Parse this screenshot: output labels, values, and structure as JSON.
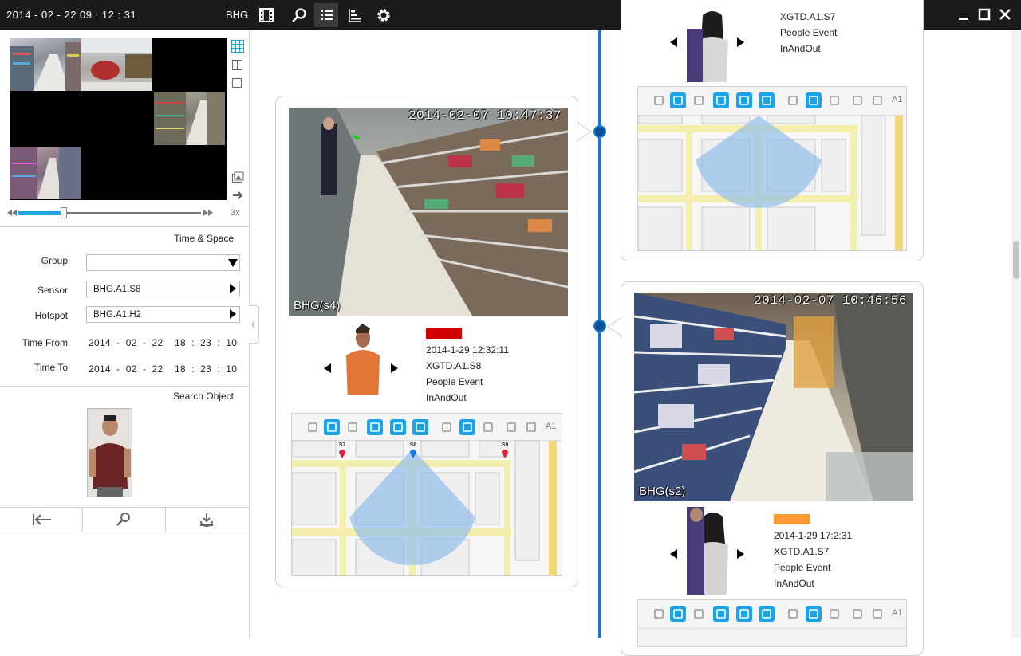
{
  "titlebar": {
    "datetime": "2014 - 02 - 22   09 : 12 : 31",
    "site": "BHG",
    "icons": [
      "film-icon",
      "search-icon",
      "list-icon",
      "chart-icon",
      "gear-icon"
    ],
    "active_icon": "list-icon"
  },
  "playback": {
    "speed": "3x",
    "progress": 0.25
  },
  "time_space": {
    "title": "Time & Space",
    "group_label": "Group",
    "group_value": "",
    "sensor_label": "Sensor",
    "sensor_value": "BHG.A1.S8",
    "hotspot_label": "Hotspot",
    "hotspot_value": "BHG.A1.H2",
    "time_from_label": "Time From",
    "time_from_value": "2014  -  02  -  22    18  :  23  :  10",
    "time_to_label": "Time To",
    "time_to_value": "2014  -  02  -  22    18  :  23  :  10"
  },
  "search_object": {
    "title": "Search Object"
  },
  "events": [
    {
      "cam_timestamp": "2014-02-07 10:47:37",
      "cam_label": "BHG(s4)",
      "color": "#d00000",
      "time": "2014-1-29 12:32:11",
      "sensor": "XGTD.A1.S8",
      "type": "People Event",
      "event": "InAndOut",
      "map_name": "A1",
      "pins": [
        "S7",
        "S8",
        "S9"
      ]
    },
    {
      "cam_timestamp": "2014-02-07 10:46:56",
      "cam_label": "BHG(s2)",
      "color": "#ff9933",
      "time": "2014-1-29 17:2:31",
      "sensor": "XGTD.A1.S7",
      "type": "People Event",
      "event": "InAndOut",
      "map_name": "A1"
    },
    {
      "sensor": "XGTD.A1.S7",
      "type": "People Event",
      "event": "InAndOut",
      "map_name": "A1"
    }
  ]
}
